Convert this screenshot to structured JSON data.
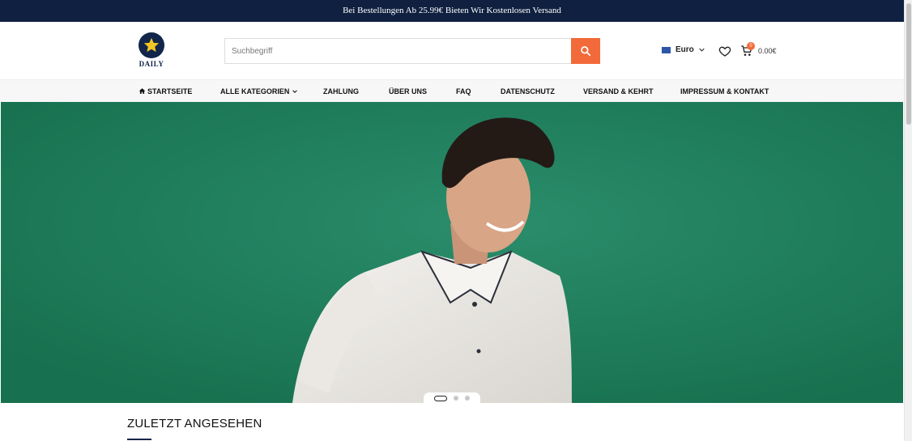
{
  "announcement": "Bei Bestellungen Ab 25.99€ Bieten Wir Kostenlosen Versand",
  "brand": {
    "logo_text": "DAILY",
    "logo_icon": "star-icon",
    "colors": {
      "navy": "#11264a",
      "accent": "#f26a3a",
      "hero_bg": "#1f7e5f"
    }
  },
  "search": {
    "placeholder": "Suchbegriff",
    "button_icon": "search-icon"
  },
  "currency": {
    "label": "Euro"
  },
  "cart": {
    "count": "0",
    "total": "0.00€"
  },
  "nav": {
    "items": [
      {
        "label": "STARTSEITE"
      },
      {
        "label": "ALLE KATEGORIEN"
      },
      {
        "label": "ZAHLUNG"
      },
      {
        "label": "ÜBER UNS"
      },
      {
        "label": "FAQ"
      },
      {
        "label": "DATENSCHUTZ"
      },
      {
        "label": "VERSAND & KEHRT"
      },
      {
        "label": "IMPRESSUM & KONTAKT"
      }
    ]
  },
  "slider": {
    "slides": 3,
    "active": 1
  },
  "recent": {
    "title": "ZULETZT ANGESEHEN"
  }
}
